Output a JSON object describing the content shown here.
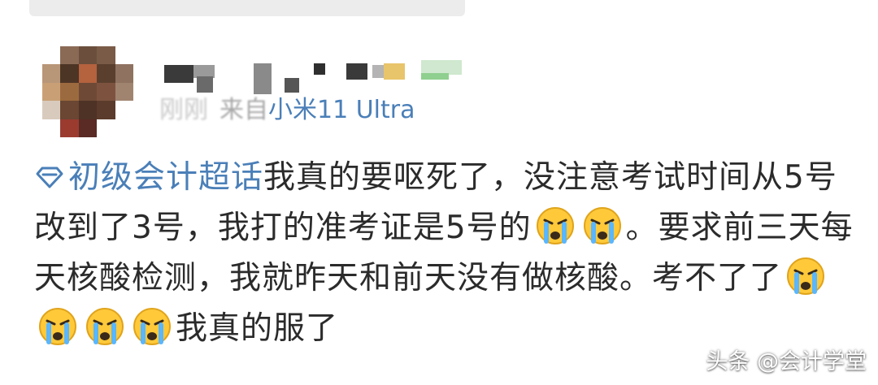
{
  "post": {
    "timestamp": "刚刚",
    "source_prefix": "来自",
    "device": "小米11 Ultra",
    "topic": "初级会计超话",
    "text_parts": [
      "我真的要呕死了，没注意考试时间从5号改到了3号，我打的准考证是5号的",
      "。要求前三天每天核酸检测，我就昨天和前天没有做核酸。考不了了",
      "我真的服了"
    ],
    "topic_icon": "diamond-topic-icon",
    "emoji_icon": "crying-face-icon"
  },
  "watermark": {
    "text": "头条 @会计学堂"
  },
  "colors": {
    "link": "#4a7fb8",
    "text": "#2b2b2b",
    "meta": "#b0b0b0"
  }
}
